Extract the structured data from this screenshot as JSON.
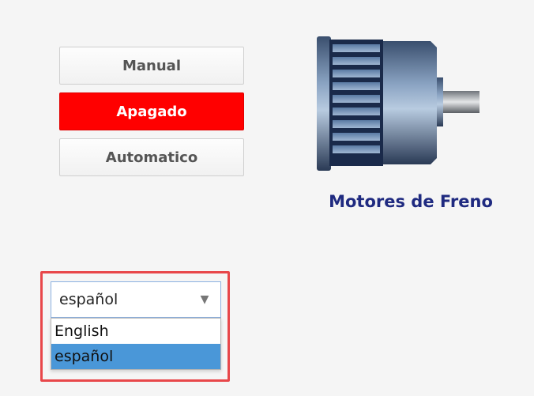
{
  "modes": {
    "manual_label": "Manual",
    "off_label": "Apagado",
    "auto_label": "Automatico",
    "active": "Apagado",
    "active_color": "#ff0000"
  },
  "motor": {
    "label": "Motores de Freno",
    "icon": "electric-motor-icon",
    "label_color": "#1f2a80"
  },
  "language": {
    "selected": "español",
    "options": [
      "English",
      "español"
    ],
    "highlight_color": "#e8474a",
    "selected_option_color": "#4a97d8"
  }
}
